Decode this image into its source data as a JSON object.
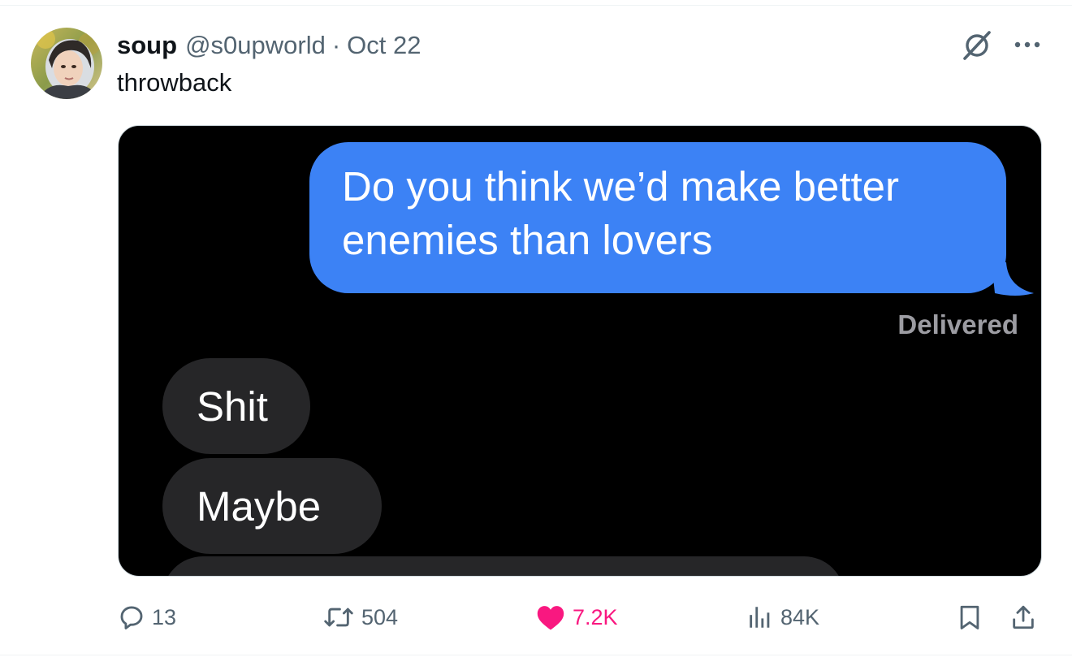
{
  "tweet": {
    "author": {
      "display_name": "soup",
      "handle": "@s0upworld",
      "separator": "·",
      "time": "Oct 22"
    },
    "text": "throwback",
    "top_icons": [
      "grok-icon",
      "more-icon"
    ],
    "media": {
      "sent_message_line1": "Do you think we’d make better",
      "sent_message_line2": "enemies than lovers",
      "status": "Delivered",
      "received_messages": [
        "Shit",
        "Maybe"
      ],
      "colors": {
        "background": "#000000",
        "sent_bubble": "#3c82f5",
        "received_bubble": "#262628"
      }
    },
    "actions": {
      "replies": "13",
      "reposts": "504",
      "likes": "7.2K",
      "views": "84K",
      "liked": true
    }
  },
  "colors": {
    "text_primary": "#0f1419",
    "text_secondary": "#536471",
    "like_pink": "#f91880"
  }
}
